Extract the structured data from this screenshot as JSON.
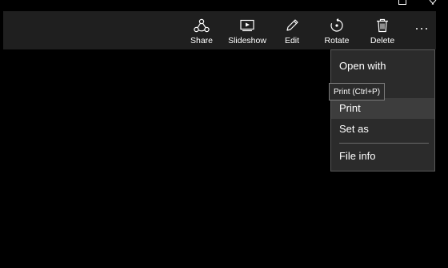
{
  "toolbar": {
    "share_label": "Share",
    "slideshow_label": "Slideshow",
    "edit_label": "Edit",
    "rotate_label": "Rotate",
    "delete_label": "Delete",
    "more_label": "…",
    "icons": {
      "share": "share-icon",
      "slideshow": "slideshow-icon",
      "edit": "pencil-icon",
      "rotate": "rotate-icon",
      "delete": "trash-icon",
      "more": "more-icon"
    }
  },
  "title_controls": {
    "icons": [
      "maximize-icon",
      "close-icon"
    ]
  },
  "menu": {
    "items": [
      {
        "label": "Open with"
      },
      {
        "label": "Print"
      },
      {
        "label": "Set as"
      },
      {
        "label": "File info"
      }
    ]
  },
  "tooltip": {
    "text": "Print (Ctrl+P)"
  },
  "colors": {
    "background": "#000000",
    "toolbar": "#1f1f1f",
    "menu": "#2b2b2b",
    "menu_hover": "#3d3d3d",
    "text": "#ffffff"
  }
}
